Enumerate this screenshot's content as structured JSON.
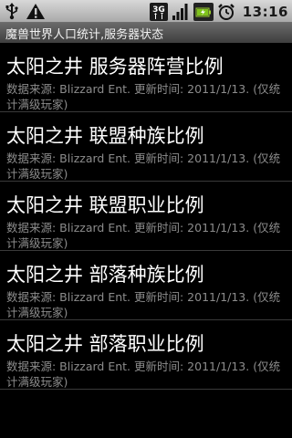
{
  "status_bar": {
    "icons": [
      "usb-icon",
      "warning-icon",
      "3g-icon",
      "signal-icon",
      "battery-icon",
      "alarm-icon"
    ],
    "network_label": "3G",
    "time": "13:16"
  },
  "title_bar": {
    "title": "魔兽世界人口统计,服务器状态"
  },
  "list": {
    "items": [
      {
        "title": "太阳之井 服务器阵营比例",
        "subtitle": "数据来源: Blizzard Ent. 更新时间: 2011/1/13. (仅统计满级玩家)"
      },
      {
        "title": "太阳之井 联盟种族比例",
        "subtitle": "数据来源: Blizzard Ent. 更新时间: 2011/1/13. (仅统计满级玩家)"
      },
      {
        "title": "太阳之井 联盟职业比例",
        "subtitle": "数据来源: Blizzard Ent. 更新时间: 2011/1/13. (仅统计满级玩家)"
      },
      {
        "title": "太阳之井 部落种族比例",
        "subtitle": "数据来源: Blizzard Ent. 更新时间: 2011/1/13. (仅统计满级玩家)"
      },
      {
        "title": "太阳之井 部落职业比例",
        "subtitle": "数据来源: Blizzard Ent. 更新时间: 2011/1/13. (仅统计满级玩家)"
      }
    ]
  }
}
